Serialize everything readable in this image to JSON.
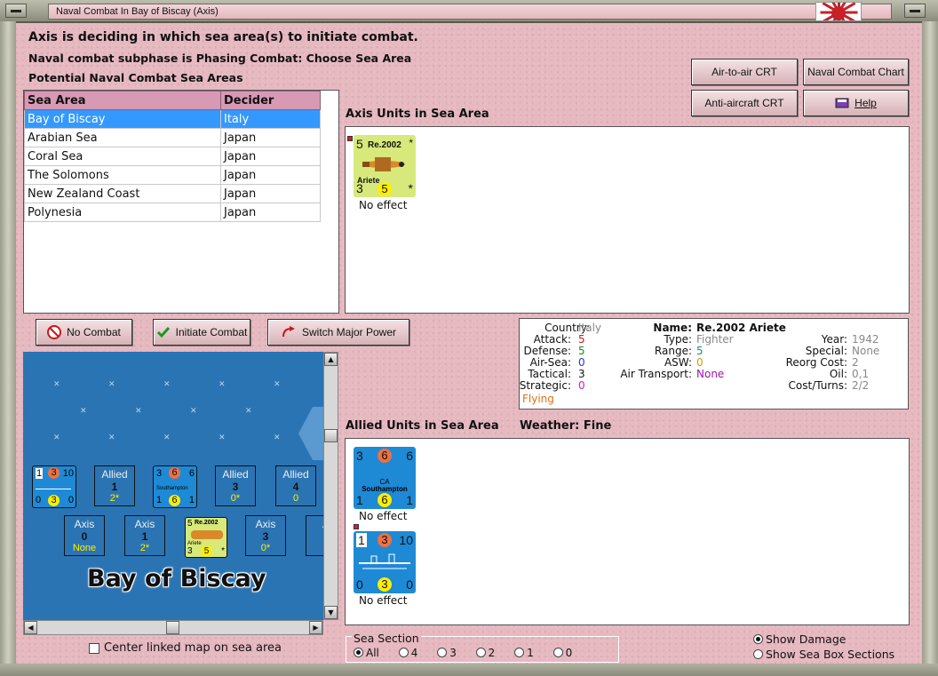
{
  "window": {
    "title": "Naval Combat In Bay of Biscay (Axis)",
    "flag_icon": "japan-rising-sun-flag"
  },
  "header": {
    "line1": "Axis is deciding in which sea area(s) to initiate combat.",
    "line2": "Naval combat subphase is Phasing Combat: Choose Sea Area",
    "line3": "Potential Naval Combat Sea Areas"
  },
  "buttons": {
    "air_to_air": "Air-to-air CRT",
    "naval_chart": "Naval Combat Chart",
    "antiaircraft": "Anti-aircraft CRT",
    "help": "Help",
    "no_combat": "No Combat",
    "initiate": "Initiate Combat",
    "switch": "Switch Major Power"
  },
  "sea_table": {
    "headers": [
      "Sea Area",
      "Decider"
    ],
    "rows": [
      {
        "area": "Bay of Biscay",
        "decider": "Italy",
        "selected": true
      },
      {
        "area": "Arabian Sea",
        "decider": "Japan"
      },
      {
        "area": "Coral Sea",
        "decider": "Japan"
      },
      {
        "area": "The Solomons",
        "decider": "Japan"
      },
      {
        "area": "New Zealand Coast",
        "decider": "Japan"
      },
      {
        "area": "Polynesia",
        "decider": "Japan"
      }
    ]
  },
  "axis_units": {
    "label": "Axis Units in Sea Area",
    "unit": {
      "tl": "5",
      "name": "Re.2002",
      "tr": "*",
      "subtitle": "Ariete",
      "bl": "3",
      "circle": "5",
      "br": "*",
      "effect": "No effect"
    }
  },
  "info": {
    "country_k": "Country:",
    "country_v": "Italy",
    "attack_k": "Attack:",
    "attack_v": "5",
    "defense_k": "Defense:",
    "defense_v": "5",
    "airsea_k": "Air-Sea:",
    "airsea_v": "0",
    "tactical_k": "Tactical:",
    "tactical_v": "3",
    "strategic_k": "Strategic:",
    "strategic_v": "0",
    "flying": "Flying",
    "name_k": "Name:",
    "name_v": "Re.2002 Ariete",
    "type_k": "Type:",
    "type_v": "Fighter",
    "range_k": "Range:",
    "range_v": "5",
    "asw_k": "ASW:",
    "asw_v": "0",
    "airtrans_k": "Air Transport:",
    "airtrans_v": "None",
    "year_k": "Year:",
    "year_v": "1942",
    "special_k": "Special:",
    "special_v": "None",
    "reorg_k": "Reorg Cost:",
    "reorg_v": "2",
    "oil_k": "Oil:",
    "oil_v": "0,1",
    "cost_k": "Cost/Turns:",
    "cost_v": "2/2"
  },
  "allied_units": {
    "label": "Allied Units in Sea Area",
    "weather": "Weather:  Fine",
    "units": [
      {
        "tl": "3",
        "tc": "6",
        "tr": "6",
        "type": "CA",
        "name": "Southampton",
        "bl": "1",
        "bc": "6",
        "br": "1",
        "effect": "No effect"
      },
      {
        "tl": "1",
        "tc": "3",
        "tr": "10",
        "bl": "0",
        "bc": "3",
        "br": "0",
        "effect": "No effect"
      }
    ]
  },
  "map": {
    "sea_name": "Bay of Biscay",
    "allied_boxes": [
      {
        "label": "Allied",
        "num": "1",
        "val": "2*"
      },
      {
        "label": "Allied",
        "num": "3",
        "val": "0*"
      },
      {
        "label": "Allied",
        "num": "4",
        "val": "0"
      }
    ],
    "axis_boxes": [
      {
        "label": "Axis",
        "num": "0",
        "val": "None"
      },
      {
        "label": "Axis",
        "num": "1",
        "val": "2*"
      },
      {
        "label": "Axis",
        "num": "3",
        "val": "0*"
      },
      {
        "label": "A",
        "num": "",
        "val": ""
      }
    ],
    "mini_counters": {
      "ship1": {
        "tl": "1",
        "tc": "3",
        "tr": "10",
        "bl": "0",
        "bc": "3",
        "br": "0"
      },
      "ship2": {
        "tl": "3",
        "tc": "6",
        "tr": "6",
        "name": "Southampton",
        "bl": "1",
        "bc": "6",
        "br": "1"
      },
      "air": {
        "tl": "5",
        "name": "Re.2002",
        "sub": "Ariete",
        "bl": "3",
        "bc": "5",
        "br": "*"
      }
    }
  },
  "bottom": {
    "center_map": "Center linked map on sea area",
    "sea_section": "Sea Section",
    "options": [
      "All",
      "4",
      "3",
      "2",
      "1",
      "0"
    ],
    "show_damage": "Show Damage",
    "show_boxes": "Show Sea Box Sections"
  }
}
